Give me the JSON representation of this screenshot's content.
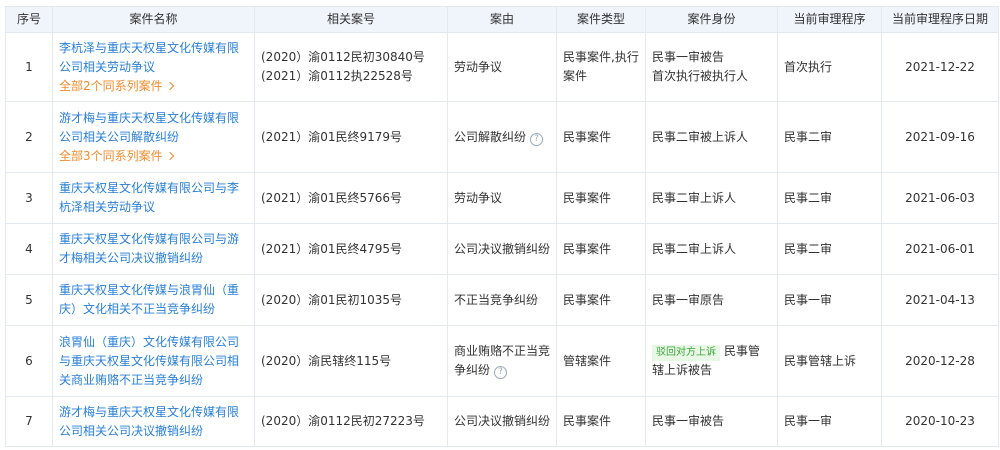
{
  "headers": [
    "序号",
    "案件名称",
    "相关案号",
    "案由",
    "案件类型",
    "案件身份",
    "当前审理程序",
    "当前审理程序日期"
  ],
  "rows": [
    {
      "no": "1",
      "name": "李杭泽与重庆天权星文化传媒有限公司相关劳动争议",
      "series": "全部2个同系列案件",
      "case_numbers": [
        "(2020）渝0112民初30840号",
        "(2021）渝0112执22528号"
      ],
      "cause": "劳动争议",
      "type": "民事案件,执行案件",
      "identity": "民事一审被告\n首次执行被执行人",
      "procedure": "首次执行",
      "date": "2021-12-22"
    },
    {
      "no": "2",
      "name": "游才梅与重庆天权星文化传媒有限公司相关公司解散纠纷",
      "series": "全部3个同系列案件",
      "case_numbers": [
        "(2021）渝01民终9179号"
      ],
      "cause": "公司解散纠纷",
      "type": "民事案件",
      "identity": "民事二审被上诉人",
      "procedure": "民事二审",
      "date": "2021-09-16"
    },
    {
      "no": "3",
      "name": "重庆天权星文化传媒有限公司与李杭泽相关劳动争议",
      "case_numbers": [
        "(2021）渝01民终5766号"
      ],
      "cause": "劳动争议",
      "type": "民事案件",
      "identity": "民事二审上诉人",
      "procedure": "民事二审",
      "date": "2021-06-03"
    },
    {
      "no": "4",
      "name": "重庆天权星文化传媒有限公司与游才梅相关公司决议撤销纠纷",
      "case_numbers": [
        "(2021）渝01民终4795号"
      ],
      "cause": "公司决议撤销纠纷",
      "type": "民事案件",
      "identity": "民事二审上诉人",
      "procedure": "民事二审",
      "date": "2021-06-01"
    },
    {
      "no": "5",
      "name": "重庆天权星文化传媒与浪胃仙（重庆）文化相关不正当竞争纠纷",
      "case_numbers": [
        "(2020）渝01民初1035号"
      ],
      "cause": "不正当竞争纠纷",
      "type": "民事案件",
      "identity": "民事一审原告",
      "procedure": "民事一审",
      "date": "2021-04-13"
    },
    {
      "no": "6",
      "name": "浪胃仙（重庆）文化传媒有限公司与重庆天权星文化传媒有限公司相关商业贿赂不正当竞争纠纷",
      "case_numbers": [
        "(2020）渝民辖终115号"
      ],
      "cause": "商业贿赂不正当竞争纠纷",
      "type": "管辖案件",
      "tag": "驳回对方上诉",
      "identity": "民事管辖上诉被告",
      "procedure": "民事管辖上诉",
      "date": "2020-12-28"
    },
    {
      "no": "7",
      "name": "游才梅与重庆天权星文化传媒有限公司相关公司决议撤销纠纷",
      "case_numbers": [
        "(2020）渝0112民初27223号"
      ],
      "cause": "公司决议撤销纠纷",
      "type": "民事案件",
      "identity": "民事一审被告",
      "procedure": "民事一审",
      "date": "2020-10-23"
    }
  ],
  "help_icon": "question-circle-icon",
  "chevron_icon": "chevron-right-icon",
  "colors": {
    "header_bg": "#f0f4fb",
    "link": "#2a7fd6",
    "series": "#f08c2c",
    "border": "#e4e9f1",
    "tag_bg": "#e8f7e6",
    "tag_text": "#3aa53a"
  }
}
